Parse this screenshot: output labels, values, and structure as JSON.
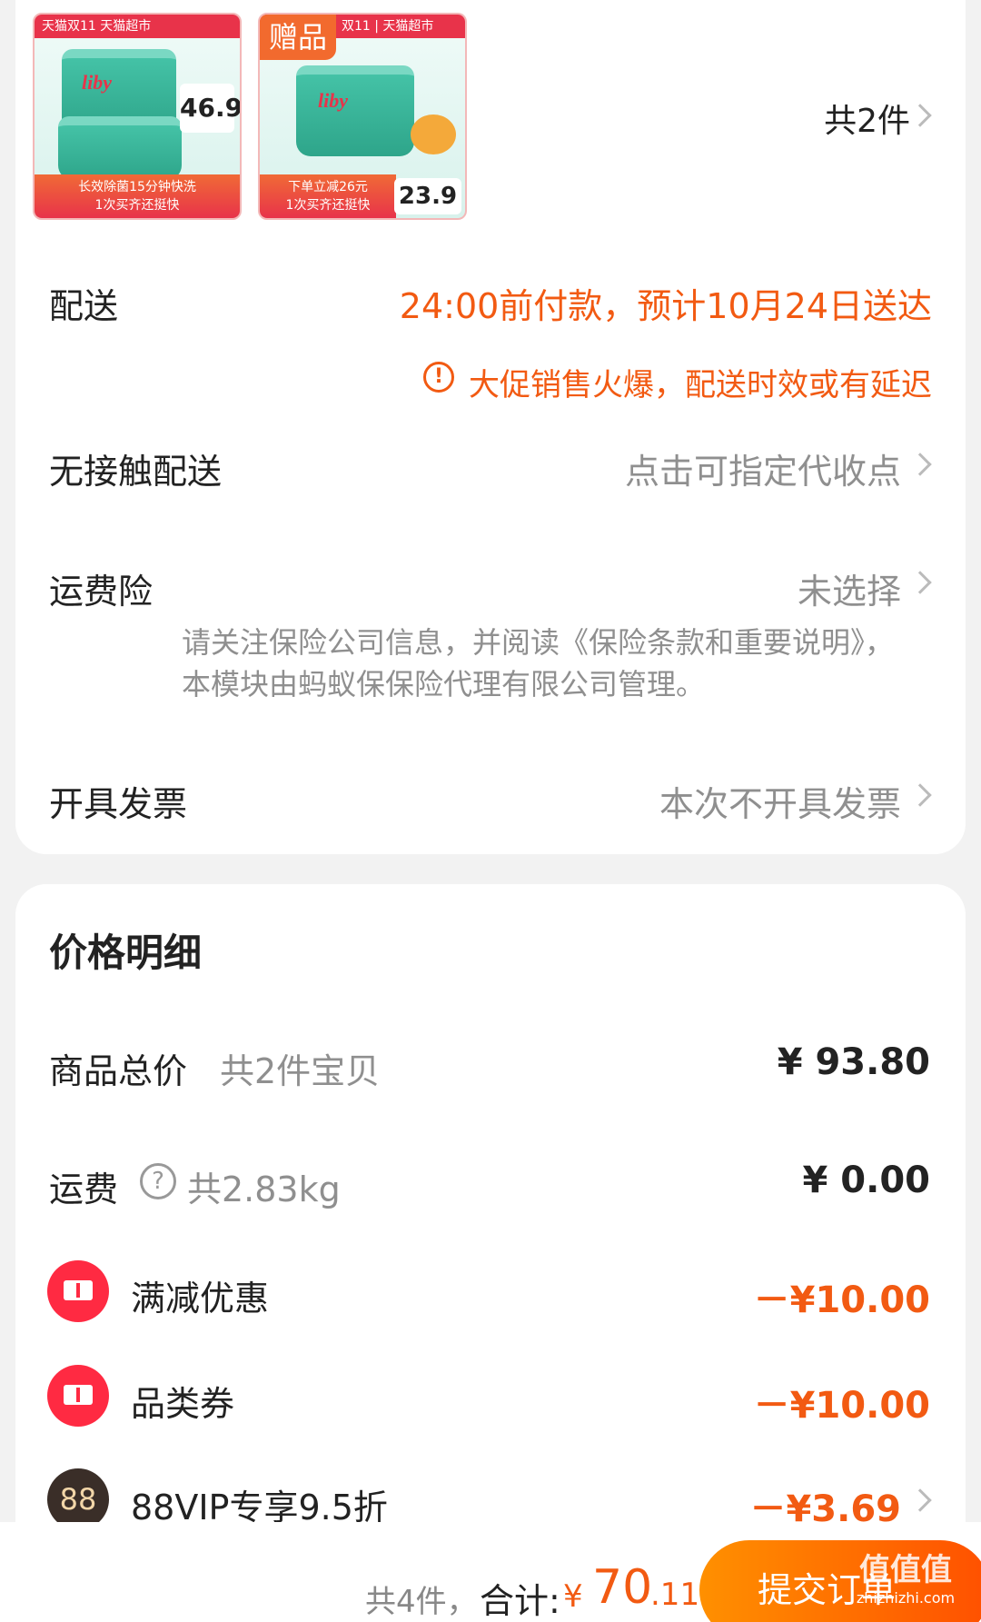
{
  "products": {
    "item1": {
      "top_band": "天猫双11 天猫超市",
      "brand": "liby",
      "price": "46.9",
      "bottom_line1": "长效除菌15分钟快洗",
      "bottom_line2": "1次买齐还挺快"
    },
    "item2": {
      "gift_label": "赠品",
      "top_band": "双11 | 天猫超市",
      "brand": "liby",
      "price": "23.9",
      "bottom_line1": "下单立减26元",
      "bottom_line2": "1次买齐还挺快"
    },
    "count_label": "共2件"
  },
  "delivery": {
    "label": "配送",
    "value": "24:00前付款，预计10月24日送达",
    "warning_icon": "!",
    "warning": "大促销售火爆，配送时效或有延迟"
  },
  "contactless": {
    "label": "无接触配送",
    "value": "点击可指定代收点"
  },
  "insurance": {
    "label": "运费险",
    "value": "未选择",
    "note": "请关注保险公司信息，并阅读《保险条款和重要说明》，本模块由蚂蚁保保险代理有限公司管理。"
  },
  "invoice": {
    "label": "开具发票",
    "value": "本次不开具发票"
  },
  "price_detail": {
    "title": "价格明细",
    "goods_total_label": "商品总价",
    "goods_total_sub": "共2件宝贝",
    "goods_total_value": "¥ 93.80",
    "shipping_label": "运费",
    "shipping_help_icon": "?",
    "shipping_sub": "共2.83kg",
    "shipping_value": "¥ 0.00",
    "discounts": [
      {
        "label": "满减优惠",
        "value": "－¥10.00"
      },
      {
        "label": "品类券",
        "value": "－¥10.00"
      }
    ],
    "vip_icon_text": "88",
    "vip_label": "88VIP专享9.5折",
    "vip_value": "－¥3.69"
  },
  "bottom_bar": {
    "count": "共4件，",
    "total_label": "合计:",
    "currency": "¥",
    "total_int": "70",
    "total_dec": ".11",
    "submit_label": "提交订单"
  },
  "watermark": {
    "main": "值值值",
    "sub": "zhizhizhi.com"
  },
  "colors": {
    "accent": "#f25a12",
    "coupon_red": "#ff2a42",
    "button_start": "#ff9000",
    "button_end": "#ff5000"
  }
}
